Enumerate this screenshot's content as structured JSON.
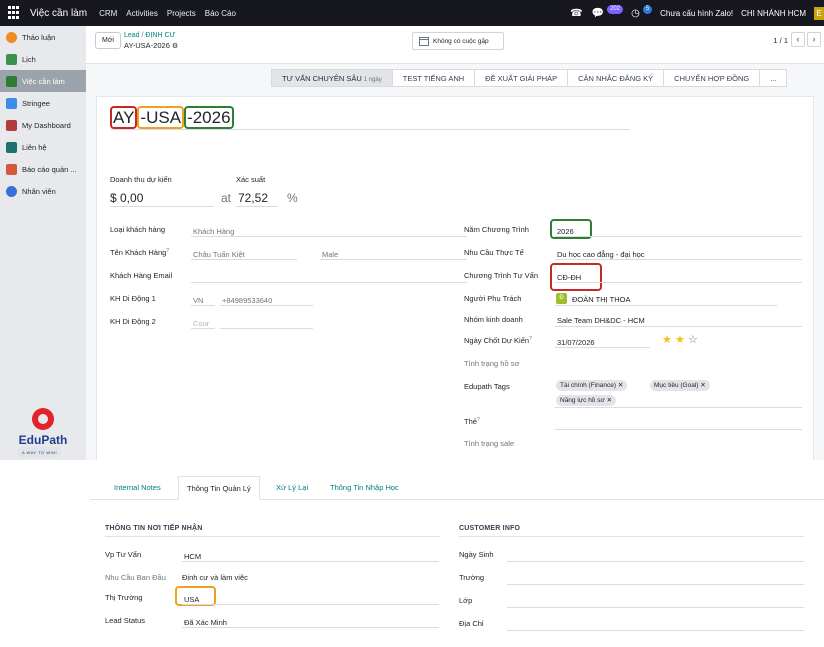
{
  "topbar": {
    "app_name": "Việc cần làm",
    "menu": [
      "CRM",
      "Activities",
      "Projects",
      "Báo Cáo"
    ],
    "chat_count": "202",
    "activity_count": "5",
    "zalo_status": "Chưa cấu hình Zalo!",
    "company": "CHI NHÁNH HCM",
    "user_initial": "E"
  },
  "sidebar": {
    "items": [
      {
        "label": "Thảo luận",
        "icon": "chat-bubble-icon",
        "color": "#f08a24"
      },
      {
        "label": "Lịch",
        "icon": "calendar-icon",
        "color": "#3f8f4d"
      },
      {
        "label": "Việc cần làm",
        "icon": "checklist-icon",
        "color": "#2e7d32"
      },
      {
        "label": "Stringee",
        "icon": "phone-cloud-icon",
        "color": "#3a8ee6"
      },
      {
        "label": "My Dashboard",
        "icon": "dashboard-icon",
        "color": "#b23b3b"
      },
      {
        "label": "Liên hệ",
        "icon": "contact-card-icon",
        "color": "#1f6f6f"
      },
      {
        "label": "Báo cáo quản ...",
        "icon": "report-icon",
        "color": "#d4583b"
      },
      {
        "label": "Nhân viên",
        "icon": "employees-icon",
        "color": "#3a6fd8"
      }
    ],
    "logo_text": "EduPath",
    "logo_tagline": "A WAY TO WIN!"
  },
  "control_panel": {
    "new_button": "Mới",
    "breadcrumb_parent": "Lead",
    "breadcrumb_current": "ĐỊNH CƯ",
    "record_name": "AY-USA-2026",
    "meeting_button": "Không có cuộc gặp",
    "pager": "1 / 1"
  },
  "stages": {
    "items": [
      {
        "label": "TƯ VẤN CHUYÊN SÂU",
        "sub": "1 ngày",
        "active": true
      },
      {
        "label": "TEST TIẾNG ANH",
        "sub": "",
        "active": false
      },
      {
        "label": "ĐỀ XUẤT GIẢI PHÁP",
        "sub": "",
        "active": false
      },
      {
        "label": "CÂN NHẮC ĐĂNG KÝ",
        "sub": "",
        "active": false
      },
      {
        "label": "CHUYỂN HỢP ĐỒNG",
        "sub": "",
        "active": false
      },
      {
        "label": "...",
        "sub": "",
        "active": false
      }
    ]
  },
  "record": {
    "title_parts": [
      "AY",
      "-USA",
      "-2026"
    ],
    "revenue_label": "Doanh thu dự kiến",
    "revenue_value": "$ 0,00",
    "at_label": "at",
    "probability_label": "Xác suất",
    "probability_value": "72,52",
    "percent": "%",
    "left_fields": {
      "customer_type_label": "Loại khách hàng",
      "customer_type_value": "Khách Hàng",
      "customer_name_label": "Tên Khách Hàng",
      "customer_name_value": "Châu Tuấn Kiệt",
      "gender_value": "Male",
      "email_label": "Khách Hàng Email",
      "mobile1_label": "KH Di Động 1",
      "mobile1_country": "VN",
      "mobile1_value": "+84989533640",
      "mobile2_label": "KH Di Động 2",
      "mobile2_placeholder": "Cour"
    },
    "right_fields": {
      "program_year_label": "Năm Chương Trình",
      "program_year_value": "2026",
      "need_label": "Nhu Cầu Thực Tế",
      "need_value": "Du học cao đẳng - đại học",
      "program_label": "Chương Trình Tư Vấn",
      "program_value": "CĐ-ĐH",
      "owner_label": "Người Phụ Trách",
      "owner_initial": "Đ",
      "owner_value": "ĐOÀN THỊ THOA",
      "team_label": "Nhóm kinh doanh",
      "team_value": "Sale Team DH&DC - HCM",
      "close_date_label": "Ngày Chốt Dự Kiến",
      "close_date_value": "31/07/2026",
      "priority_stars": 2,
      "priority_max": 3,
      "profile_status_label": "Tình trạng hồ sơ",
      "tags_label": "Edupath Tags",
      "tags": [
        "Tài chính (Finance)",
        "Mục tiêu (Goal)",
        "Năng lực hồ sơ"
      ],
      "the_label": "Thẻ",
      "sale_status_label": "Tình trạng sale"
    }
  },
  "tabs": [
    "Internal Notes",
    "Thông Tin Quản Lý",
    "Xử Lý Lại",
    "Thông Tin Nhập Học"
  ],
  "management": {
    "reception_title": "THÔNG TIN NƠI TIẾP NHẬN",
    "office_label": "Vp Tư Vấn",
    "office_value": "HCM",
    "initial_need_label": "Nhu Cầu Ban Đầu",
    "initial_need_value": "Định cư và làm việc",
    "market_label": "Thị Trường",
    "market_value": "USA",
    "lead_status_label": "Lead Status",
    "lead_status_value": "Đã Xác Minh",
    "customer_info_title": "CUSTOMER INFO",
    "birthday_label": "Ngày Sinh",
    "school_label": "Trường",
    "class_label": "Lớp",
    "address_label": "Địa Chỉ"
  }
}
